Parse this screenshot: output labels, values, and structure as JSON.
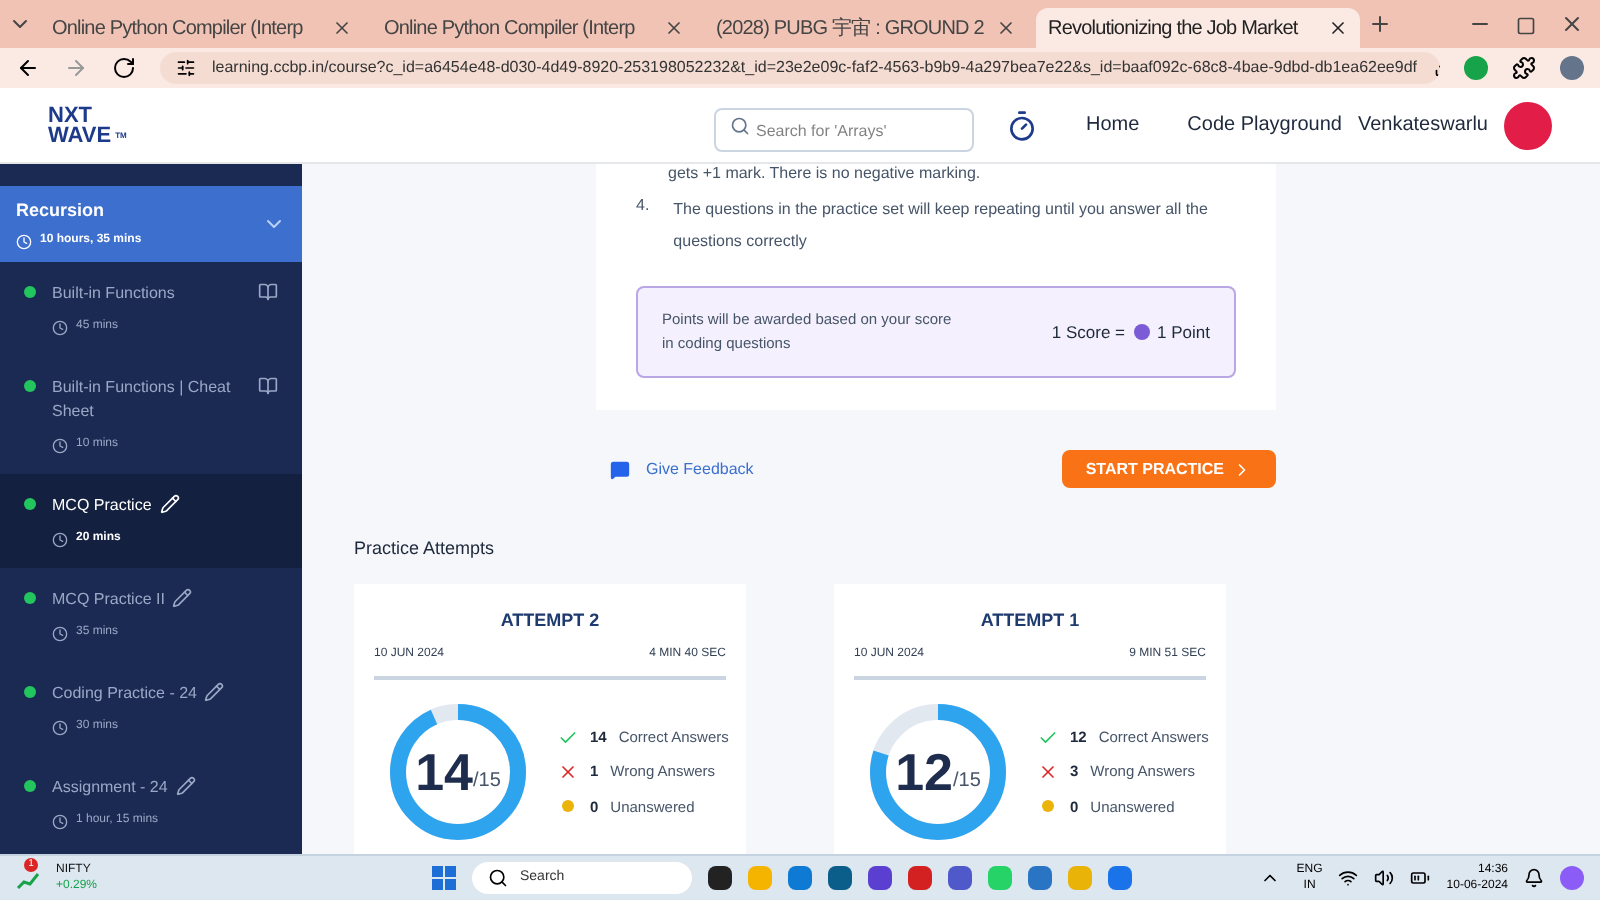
{
  "browser": {
    "tabs": [
      {
        "title": "Online Python Compiler (Interp",
        "selected": false
      },
      {
        "title": "Online Python Compiler (Interp",
        "selected": false
      },
      {
        "title": "(2028) PUBG 宇宙 : GROUND 2",
        "selected": false
      },
      {
        "title": "Revolutionizing the Job Market",
        "selected": true
      }
    ],
    "url": "learning.ccbp.in/course?c_id=a6454e48-d030-4d49-8920-253198052232&t_id=23e2e09c-faf2-4563-b9b9-4a297bea7e22&s_id=baaf092c-68c8-4bae-9dbd-db1ea62ee9df"
  },
  "header": {
    "logo_top": "NXT",
    "logo_bottom": "WAVE",
    "logo_tm": "TM",
    "search": {
      "placeholder": "Search for 'Arrays'"
    },
    "nav": [
      "Home",
      "Code Playground"
    ],
    "user": "Venkateswarlu"
  },
  "sidebar": {
    "section": {
      "title": "Recursion",
      "duration": "10 hours, 35 mins"
    },
    "items": [
      {
        "title": "Built-in Functions",
        "duration": "45 mins",
        "kind": "reading",
        "selected": false
      },
      {
        "title": "Built-in Functions | Cheat Sheet",
        "duration": "10 mins",
        "kind": "reading",
        "selected": false
      },
      {
        "title": "MCQ Practice",
        "duration": "20 mins",
        "kind": "practice",
        "selected": true
      },
      {
        "title": "MCQ Practice II",
        "duration": "35 mins",
        "kind": "practice",
        "selected": false
      },
      {
        "title": "Coding Practice - 24",
        "duration": "30 mins",
        "kind": "practice",
        "selected": false
      },
      {
        "title": "Assignment - 24",
        "duration": "1 hour, 15 mins",
        "kind": "practice",
        "selected": false
      }
    ]
  },
  "instructions": {
    "cut_line": "gets +1 mark. There is no negative marking.",
    "items": [
      {
        "number": "4.",
        "text": "The questions in the practice set will keep repeating until you answer all the questions correctly"
      }
    ],
    "note": "Points will be awarded based on your score in coding questions",
    "score_left": "1 Score =",
    "score_right": "1 Point"
  },
  "feedback": "Give Feedback",
  "start_button": "START PRACTICE",
  "attempts": {
    "title": "Practice Attempts",
    "cards": [
      {
        "title": "ATTEMPT 2",
        "date": "10 JUN 2024",
        "time": "4 MIN 40 SEC",
        "score": "14",
        "total": "/15",
        "level": 0.933,
        "correct": "14",
        "correct_label": "Correct Answers",
        "wrong": "1",
        "wrong_label": "Wrong Answers",
        "unanswered": "0",
        "unanswered_label": "Unanswered"
      },
      {
        "title": "ATTEMPT 1",
        "date": "10 JUN 2024",
        "time": "9 MIN 51 SEC",
        "score": "12",
        "total": "/15",
        "level": 0.8,
        "correct": "12",
        "correct_label": "Correct Answers",
        "wrong": "3",
        "wrong_label": "Wrong Answers",
        "unanswered": "0",
        "unanswered_label": "Unanswered"
      }
    ]
  },
  "taskbar": {
    "widget_badge": "1",
    "widget_name": "NIFTY",
    "widget_change": "+0.29%",
    "search": "Search",
    "lang_top": "ENG",
    "lang_bottom": "IN",
    "time": "14:36",
    "date": "10-06-2024"
  }
}
